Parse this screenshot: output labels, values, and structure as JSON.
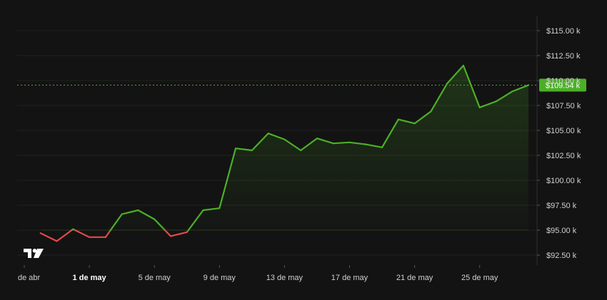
{
  "chart_data": {
    "type": "area",
    "title": "",
    "xlabel": "",
    "ylabel": "",
    "ylim": [
      91.5,
      116.5
    ],
    "y_unit_format": "$%s k",
    "y_ticks": [
      92.5,
      95.0,
      97.5,
      100.0,
      102.5,
      105.0,
      107.5,
      110.0,
      112.5,
      115.0
    ],
    "y_tick_labels": [
      "$92.50 k",
      "$95.00 k",
      "$97.50 k",
      "$100.00 k",
      "$102.50 k",
      "$105.00 k",
      "$107.50 k",
      "$110.00 k",
      "$112.50 k",
      "$115.00 k"
    ],
    "x_ticks": [
      {
        "label": "de abr",
        "x": "2025-04-27",
        "bold": false
      },
      {
        "label": "1 de may",
        "x": "2025-05-01",
        "bold": true
      },
      {
        "label": "5 de may",
        "x": "2025-05-05",
        "bold": false
      },
      {
        "label": "9 de may",
        "x": "2025-05-09",
        "bold": false
      },
      {
        "label": "13 de may",
        "x": "2025-05-13",
        "bold": false
      },
      {
        "label": "17 de may",
        "x": "2025-05-17",
        "bold": false
      },
      {
        "label": "21 de may",
        "x": "2025-05-21",
        "bold": false
      },
      {
        "label": "25 de may",
        "x": "2025-05-25",
        "bold": false
      }
    ],
    "x_range": [
      "2025-04-27",
      "2025-05-28"
    ],
    "baseline": 95.0,
    "series": [
      {
        "x": [
          "2025-04-28",
          "2025-04-29",
          "2025-04-30",
          "2025-05-01",
          "2025-05-02",
          "2025-05-03",
          "2025-05-04",
          "2025-05-05",
          "2025-05-06",
          "2025-05-07",
          "2025-05-08",
          "2025-05-09",
          "2025-05-10",
          "2025-05-11",
          "2025-05-12",
          "2025-05-13",
          "2025-05-14",
          "2025-05-15",
          "2025-05-16",
          "2025-05-17",
          "2025-05-18",
          "2025-05-19",
          "2025-05-20",
          "2025-05-21",
          "2025-05-22",
          "2025-05-23",
          "2025-05-24",
          "2025-05-25",
          "2025-05-26",
          "2025-05-27",
          "2025-05-28"
        ],
        "values": [
          94.7,
          93.9,
          95.1,
          94.3,
          94.3,
          96.6,
          97.0,
          96.1,
          94.4,
          94.8,
          97.0,
          97.2,
          103.2,
          103.0,
          104.7,
          104.1,
          103.0,
          104.2,
          103.7,
          103.8,
          103.6,
          103.3,
          106.1,
          105.7,
          106.9,
          109.7,
          111.5,
          107.3,
          107.9,
          108.9,
          109.54
        ]
      }
    ],
    "last_price_label": "$109.54 k",
    "colors": {
      "up": "#4caf28",
      "down": "#e5484d",
      "price_tag": "#4caf28",
      "background": "#131313",
      "grid": "#222222",
      "text": "#d0d0d0"
    },
    "grid": true,
    "logo": "tradingview-logo"
  }
}
